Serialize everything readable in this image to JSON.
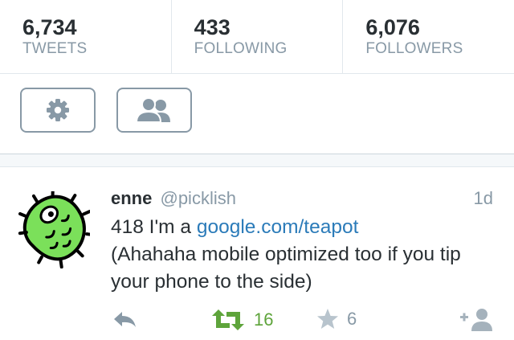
{
  "profile_stats": [
    {
      "count": "6,734",
      "label": "TWEETS"
    },
    {
      "count": "433",
      "label": "FOLLOWING"
    },
    {
      "count": "6,076",
      "label": "FOLLOWERS"
    }
  ],
  "actions": {
    "settings_icon": "gear-icon",
    "people_icon": "people-icon"
  },
  "tweet": {
    "name": "enne",
    "handle": "@picklish",
    "time": "1d",
    "text_prefix": "418 I'm a ",
    "link": "google.com/teapot",
    "text_suffix": "(Ahahaha mobile optimized too if you tip your phone to the side)",
    "retweet_count": "16",
    "favorite_count": "6",
    "avatar": "pickle-avatar"
  },
  "colors": {
    "link": "#2b7bb9",
    "retweet": "#5ea43b",
    "muted": "#8899a6",
    "text": "#292f33"
  }
}
